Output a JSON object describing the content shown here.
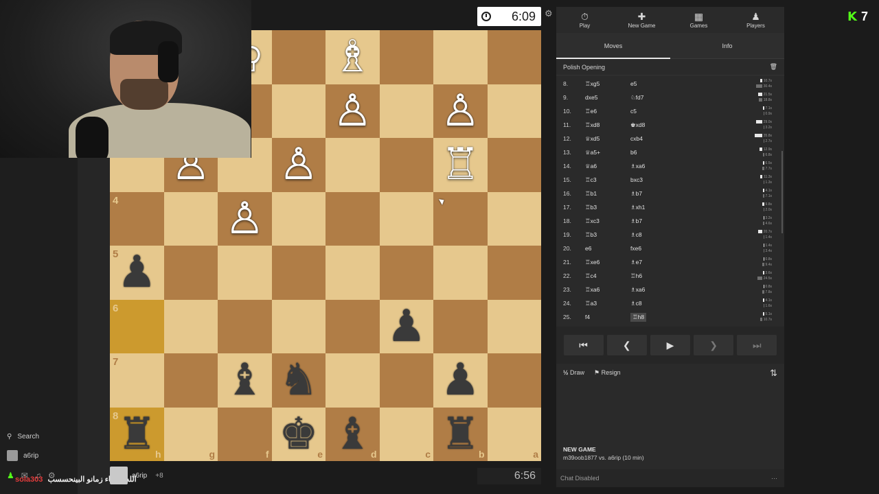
{
  "colors": {
    "accent": "#53fc18",
    "panel": "#2a2a2a",
    "light_square": "#e6c88d",
    "dark_square": "#b07d46",
    "highlight": "#cc9a2e"
  },
  "board": {
    "ranks_top_to_bottom": [
      [
        "",
        "",
        "♔",
        "",
        "♗",
        "",
        "",
        ""
      ],
      [
        "",
        "",
        "",
        "",
        "♙",
        "",
        "♙",
        ""
      ],
      [
        "",
        "♙",
        "",
        "♙",
        "",
        "",
        "♖",
        ""
      ],
      [
        "",
        "",
        "♙",
        "",
        "",
        "",
        "",
        ""
      ],
      [
        "♟",
        "",
        "",
        "",
        "",
        "",
        "",
        ""
      ],
      [
        "",
        "",
        "",
        "",
        "",
        "♟",
        "",
        ""
      ],
      [
        "",
        "",
        "♝",
        "♞",
        "",
        "",
        "♟",
        ""
      ],
      [
        "♜",
        "",
        "",
        "♚",
        "♝",
        "",
        "♜",
        ""
      ]
    ],
    "rank_labels": [
      "",
      "",
      "",
      "4",
      "5",
      "6",
      "7",
      "8"
    ],
    "file_labels": [
      "h",
      "g",
      "f",
      "e",
      "d",
      "c",
      "b",
      "a"
    ],
    "highlighted": [
      "r5c0",
      "r7c0"
    ]
  },
  "timer_top": "6:09",
  "timer_bottom": "6:56",
  "left_sidebar": {
    "search_label": "Search",
    "username": "a6rip"
  },
  "chat_overlay": {
    "name": "sola303",
    "message": "الله ماشاء زمانو البينحسسب"
  },
  "bottom_player": {
    "name": "a6rip",
    "badge_text": "+8"
  },
  "nav": [
    {
      "label": "Play",
      "icon": "⏱"
    },
    {
      "label": "New Game",
      "icon": "✚"
    },
    {
      "label": "Games",
      "icon": "▦"
    },
    {
      "label": "Players",
      "icon": "♟"
    }
  ],
  "subtabs": [
    "Moves",
    "Info"
  ],
  "opening": "Polish Opening",
  "moves": [
    {
      "n": "8.",
      "w": "♖xg5",
      "b": "e5",
      "t1": "10.7s",
      "t2": "30.4s",
      "p1": 6,
      "p2": 22
    },
    {
      "n": "9.",
      "w": "dxe5",
      "b": "♘fd7",
      "t1": "21.5s",
      "t2": "18.8s",
      "p1": 15,
      "p2": 13
    },
    {
      "n": "10.",
      "w": "♖e6",
      "b": "c5",
      "t1": "7.1s",
      "t2": "0.9s",
      "p1": 5,
      "p2": 1
    },
    {
      "n": "11.",
      "w": "♖xd8",
      "b": "♚xd8",
      "t1": "29.0s",
      "t2": "3.2s",
      "p1": 21,
      "p2": 2
    },
    {
      "n": "12.",
      "w": "♕xd5",
      "b": "cxb4",
      "t1": "35.8s",
      "t2": "2.7s",
      "p1": 26,
      "p2": 2
    },
    {
      "n": "13.",
      "w": "♕a5+",
      "b": "b6",
      "t1": "12.9s",
      "t2": "6.8s",
      "p1": 9,
      "p2": 5
    },
    {
      "n": "14.",
      "w": "♕a6",
      "b": "♗xa6",
      "t1": "6.5s",
      "t2": "7.7s",
      "p1": 5,
      "p2": 6
    },
    {
      "n": "15.",
      "w": "♖c3",
      "b": "bxc3",
      "t1": "11.3s",
      "t2": "1.3s",
      "p1": 8,
      "p2": 1
    },
    {
      "n": "16.",
      "w": "♖b1",
      "b": "♗b7",
      "t1": "4.1s",
      "t2": "7.1s",
      "p1": 3,
      "p2": 5
    },
    {
      "n": "17.",
      "w": "♖b3",
      "b": "♗xh1",
      "t1": "9.8s",
      "t2": "2.0s",
      "p1": 7,
      "p2": 2
    },
    {
      "n": "18.",
      "w": "♖xc3",
      "b": "♗b7",
      "t1": "3.2s",
      "t2": "4.6s",
      "p1": 2,
      "p2": 3
    },
    {
      "n": "19.",
      "w": "♖b3",
      "b": "♗c8",
      "t1": "20.7s",
      "t2": "1.4s",
      "p1": 15,
      "p2": 1
    },
    {
      "n": "20.",
      "w": "e6",
      "b": "fxe6",
      "t1": "1.4s",
      "t2": "3.4s",
      "p1": 1,
      "p2": 2
    },
    {
      "n": "21.",
      "w": "♖xe6",
      "b": "♗e7",
      "t1": "0.8s",
      "t2": "9.4s",
      "p1": 1,
      "p2": 7
    },
    {
      "n": "22.",
      "w": "♖c4",
      "b": "♖h6",
      "t1": "3.6s",
      "t2": "24.5s",
      "p1": 3,
      "p2": 18
    },
    {
      "n": "23.",
      "w": "♖xa6",
      "b": "♗xa6",
      "t1": "0.8s",
      "t2": "7.8s",
      "p1": 1,
      "p2": 6
    },
    {
      "n": "24.",
      "w": "♖a3",
      "b": "♗c8",
      "t1": "4.1s",
      "t2": "1.6s",
      "p1": 3,
      "p2": 1
    },
    {
      "n": "25.",
      "w": "f4",
      "b": "♖h8",
      "t1": "5.1s",
      "t2": "10.7s",
      "p1": 4,
      "p2": 8,
      "current": true
    }
  ],
  "controls": [
    "⏮",
    "❮",
    "▶",
    "❯",
    "⏭"
  ],
  "actions": {
    "draw": "Draw",
    "draw_icon": "½",
    "resign": "Resign",
    "resign_icon": "⚑",
    "flip_icon": "⇅"
  },
  "new_game": {
    "heading": "NEW GAME",
    "details": "m39oob1877 vs. a6rip (10 min)"
  },
  "chat_status": "Chat Disabled",
  "kick": {
    "logo": "K",
    "viewers": "7"
  }
}
